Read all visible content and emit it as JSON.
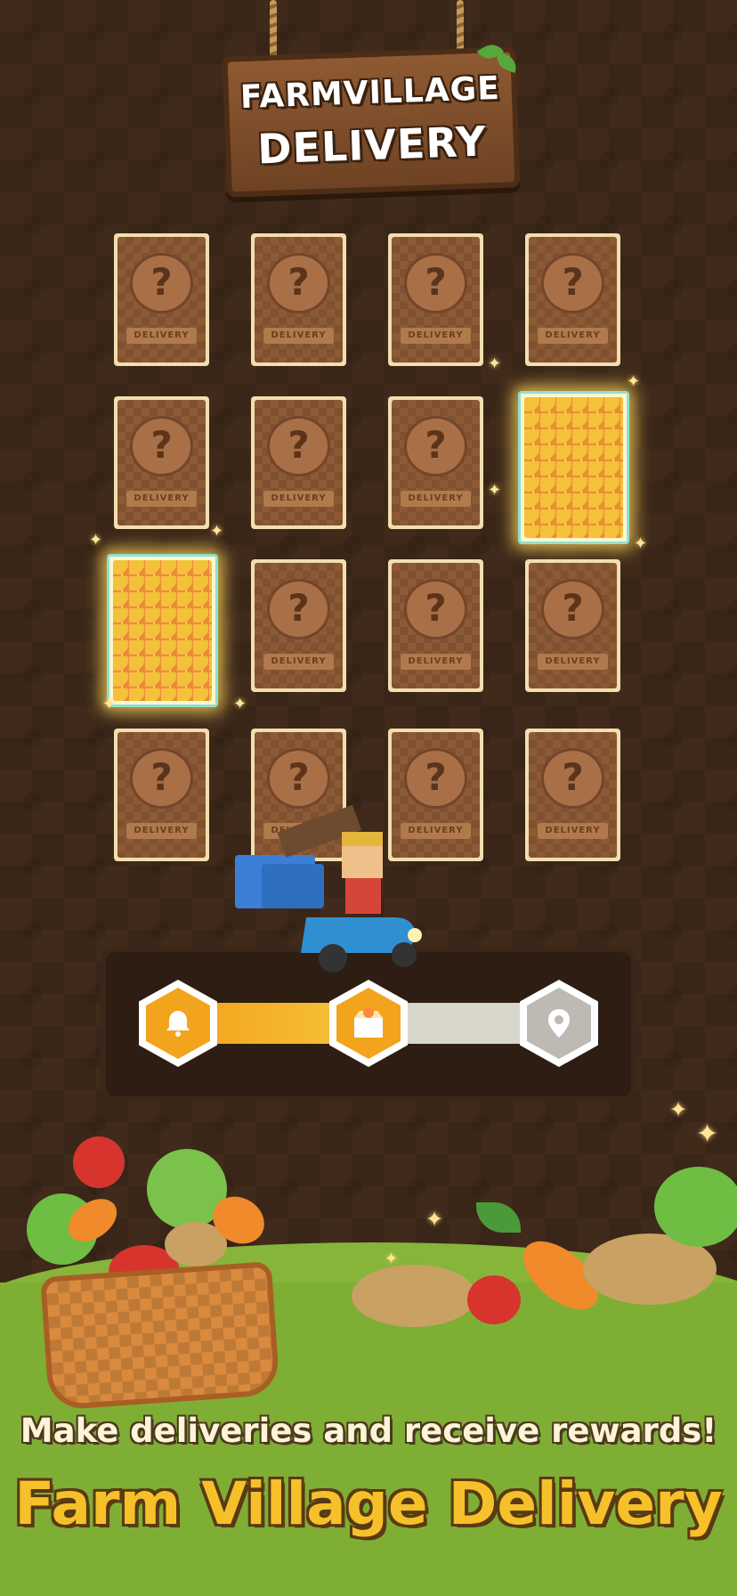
{
  "sign": {
    "line1": "FARMVILLAGE",
    "line2": "DELIVERY"
  },
  "card_label": "DELIVERY",
  "card_mystery_symbol": "?",
  "cards": [
    {
      "state": "hidden"
    },
    {
      "state": "hidden"
    },
    {
      "state": "hidden"
    },
    {
      "state": "hidden"
    },
    {
      "state": "hidden"
    },
    {
      "state": "hidden"
    },
    {
      "state": "hidden"
    },
    {
      "state": "revealed"
    },
    {
      "state": "revealed"
    },
    {
      "state": "hidden"
    },
    {
      "state": "hidden"
    },
    {
      "state": "hidden"
    },
    {
      "state": "hidden"
    },
    {
      "state": "hidden"
    },
    {
      "state": "hidden"
    },
    {
      "state": "hidden"
    }
  ],
  "progress": {
    "fill_fraction": 0.45,
    "steps": [
      {
        "icon": "bell-icon",
        "state": "done"
      },
      {
        "icon": "package-icon",
        "state": "current"
      },
      {
        "icon": "location-pin-icon",
        "state": "pending"
      }
    ]
  },
  "colors": {
    "accent": "#f2a41c",
    "title": "#f6c02a",
    "ground": "#7fae35",
    "card_frame": "#f3deae"
  },
  "tagline": "Make deliveries and receive rewards!",
  "title": "Farm Village Delivery"
}
